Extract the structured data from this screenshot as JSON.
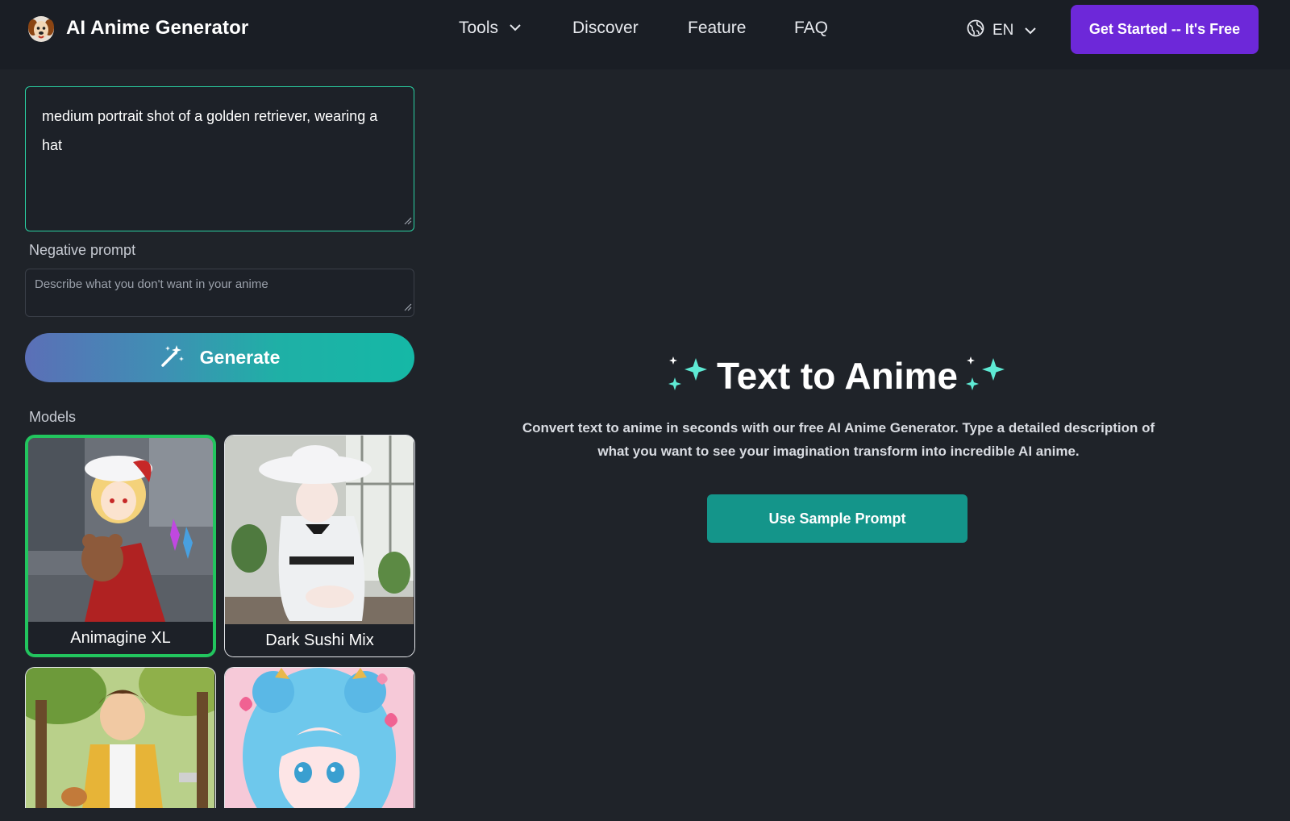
{
  "header": {
    "app_title": "AI Anime Generator",
    "nav": {
      "tools": "Tools",
      "discover": "Discover",
      "feature": "Feature",
      "faq": "FAQ"
    },
    "language": "EN",
    "cta": "Get Started -- It's Free"
  },
  "form": {
    "prompt_value": "medium portrait shot of a golden retriever, wearing a hat",
    "negative_label": "Negative prompt",
    "negative_placeholder": "Describe what you don't want in your anime",
    "generate_label": "Generate",
    "models_label": "Models"
  },
  "models": [
    {
      "name": "Animagine XL",
      "selected": true
    },
    {
      "name": "Dark Sushi Mix",
      "selected": false
    },
    {
      "name": "",
      "selected": false
    },
    {
      "name": "",
      "selected": false
    }
  ],
  "hero": {
    "title": "Text to Anime",
    "description": "Convert text to anime in seconds with our free AI Anime Generator. Type a detailed description of what you want to see your imagination transform into incredible AI anime.",
    "sample_button": "Use Sample Prompt"
  },
  "colors": {
    "accent_purple": "#6d28d9",
    "accent_teal": "#14958a",
    "selected_green": "#22c55e",
    "sparkle": "#5eead4"
  },
  "icons": [
    "dog-logo-icon",
    "chevron-down-icon",
    "globe-icon",
    "magic-wand-icon",
    "sparkles-icon"
  ]
}
